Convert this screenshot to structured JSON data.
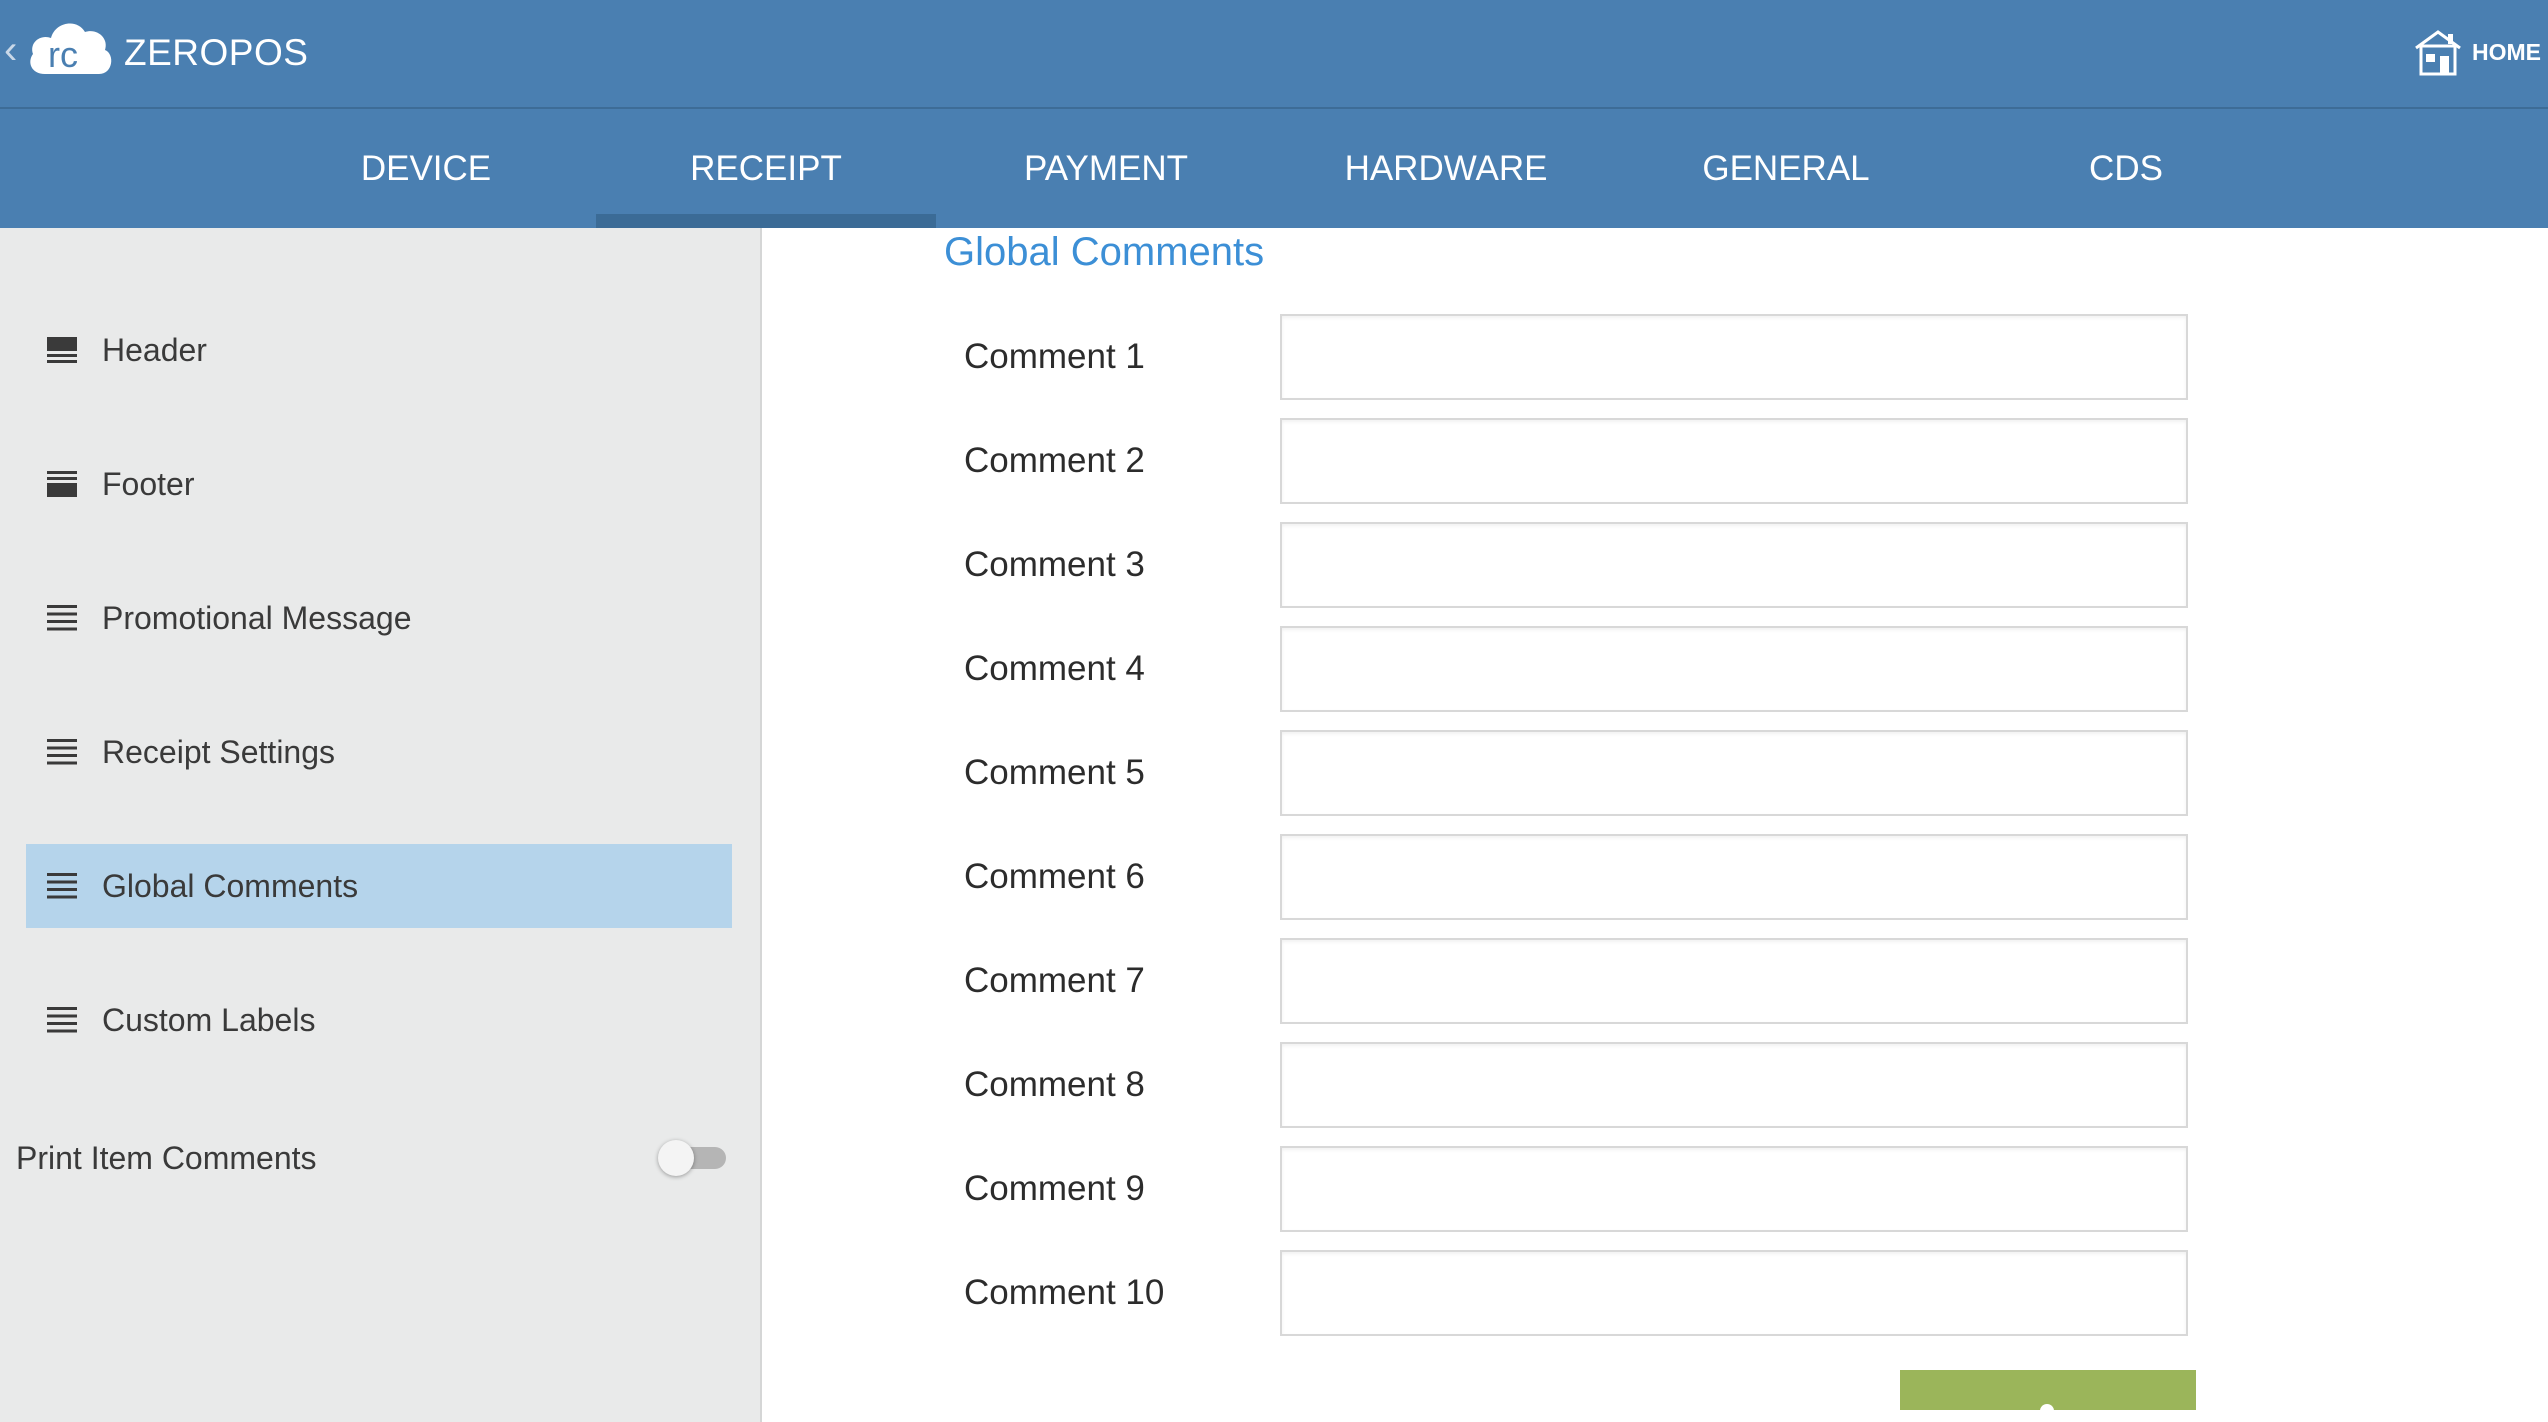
{
  "app": {
    "title": "ZEROPOS",
    "home_label": "HOME"
  },
  "tabs": [
    {
      "label": "DEVICE"
    },
    {
      "label": "RECEIPT",
      "active": true
    },
    {
      "label": "PAYMENT"
    },
    {
      "label": "HARDWARE"
    },
    {
      "label": "GENERAL"
    },
    {
      "label": "CDS"
    }
  ],
  "sidebar": {
    "items": [
      {
        "label": "Header",
        "icon": "header-icon"
      },
      {
        "label": "Footer",
        "icon": "footer-icon"
      },
      {
        "label": "Promotional Message",
        "icon": "list-icon"
      },
      {
        "label": "Receipt Settings",
        "icon": "list-icon"
      },
      {
        "label": "Global Comments",
        "icon": "list-icon",
        "selected": true
      },
      {
        "label": "Custom Labels",
        "icon": "list-icon"
      }
    ],
    "toggle": {
      "label": "Print Item Comments",
      "on": false
    }
  },
  "main": {
    "title": "Global Comments",
    "comments": [
      {
        "label": "Comment 1",
        "value": ""
      },
      {
        "label": "Comment 2",
        "value": ""
      },
      {
        "label": "Comment 3",
        "value": ""
      },
      {
        "label": "Comment 4",
        "value": ""
      },
      {
        "label": "Comment 5",
        "value": ""
      },
      {
        "label": "Comment 6",
        "value": ""
      },
      {
        "label": "Comment 7",
        "value": ""
      },
      {
        "label": "Comment 8",
        "value": ""
      },
      {
        "label": "Comment 9",
        "value": ""
      },
      {
        "label": "Comment 10",
        "value": ""
      }
    ]
  },
  "colors": {
    "header_bg": "#4a7fb1",
    "active_tab_indicator": "#3b6b96",
    "sidebar_bg": "#e9eaea",
    "selected_item_bg": "#b5d4eb",
    "section_title": "#3c8fd6",
    "save_button": "#9bb55a"
  }
}
